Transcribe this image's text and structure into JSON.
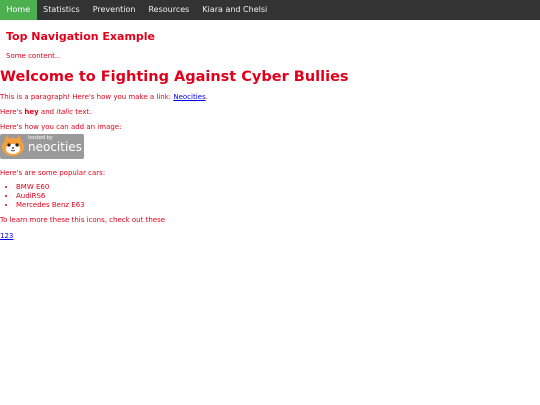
{
  "nav": {
    "items": [
      "Home",
      "Statistics",
      "Prevention",
      "Resources",
      "Kiara and Chelsi"
    ],
    "active_index": 0
  },
  "top_section": {
    "title": "Top Navigation Example",
    "content": "Some content.."
  },
  "main": {
    "heading": "Welcome to Fighting Against Cyber Bullies",
    "para1_prefix": "This is a paragraph! Here's how you make a link: ",
    "para1_link": "Neocities",
    "para1_suffix": ".",
    "para2_prefix": "Here's ",
    "para2_bold": "hey",
    "para2_middle": " and ",
    "para2_italic": "italic",
    "para2_suffix": " text.",
    "image_intro": "Here's how you can add an image:",
    "badge_small": "hosted by",
    "badge_big": "neocities",
    "cars_intro": "Here's are some popular cars:",
    "cars": [
      "BMW E60",
      "AudiRS6",
      "Mercedes Benz E63"
    ],
    "learn_more": "To learn more these this icons, check out these",
    "link_123": "123"
  },
  "colors": {
    "text_red": "#e0001b",
    "nav_bg": "#333333",
    "nav_active": "#4caf50",
    "link_blue": "#0000ee",
    "badge_gray": "#9a9a9a"
  }
}
